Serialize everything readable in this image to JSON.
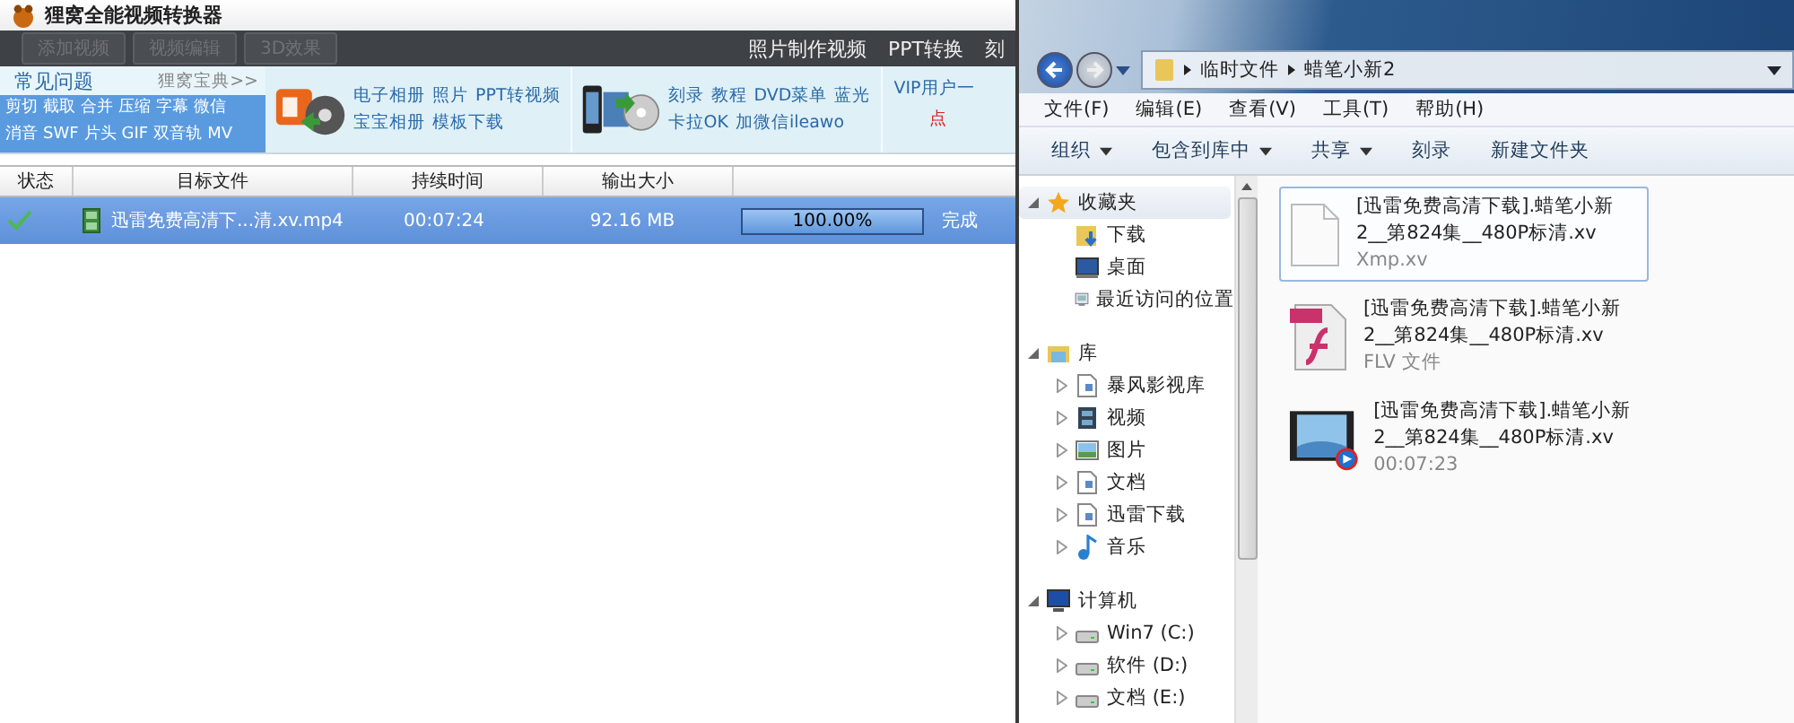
{
  "app": {
    "title": "狸窝全能视频转换器",
    "toolbar_buttons": [
      {
        "label": "添加视频",
        "disabled": true
      },
      {
        "label": "视频编辑",
        "disabled": true
      },
      {
        "label": "3D效果",
        "disabled": true
      }
    ],
    "top_links": [
      "照片制作视频",
      "PPT转换",
      "刻"
    ],
    "faq": {
      "title": "常见问题",
      "more": "狸窝宝典>>",
      "tag_rows": [
        [
          "剪切",
          "截取",
          "合并",
          "压缩",
          "字幕",
          "微信"
        ],
        [
          "消音",
          "SWF",
          "片头",
          "GIF",
          "双音轨",
          "MV"
        ]
      ]
    },
    "promos": [
      {
        "kind": "ppt",
        "lines": [
          [
            "电子相册",
            "照片",
            "PPT转视频"
          ],
          [
            "宝宝相册",
            "模板下载"
          ]
        ]
      },
      {
        "kind": "dvd",
        "lines": [
          [
            "刻录",
            "教程",
            "DVD菜单",
            "蓝光"
          ],
          [
            "卡拉OK",
            "加微信ileawo"
          ]
        ]
      }
    ],
    "vip": {
      "text": "VIP用户一",
      "link": "点"
    },
    "table": {
      "columns": [
        "状态",
        "目标文件",
        "持续时间",
        "输出大小"
      ],
      "rows": [
        {
          "file": "迅雷免费高清下...清.xv.mp4",
          "duration": "00:07:24",
          "size": "92.16 MB",
          "level": 1,
          "progress": "100.00%",
          "result": "完成",
          "selected": true
        }
      ]
    }
  },
  "explorer": {
    "breadcrumb": [
      "临时文件",
      "蜡笔小新2"
    ],
    "menu": [
      "文件(F)",
      "编辑(E)",
      "查看(V)",
      "工具(T)",
      "帮助(H)"
    ],
    "commands": [
      {
        "label": "组织",
        "dropdown": true
      },
      {
        "label": "包含到库中",
        "dropdown": true
      },
      {
        "label": "共享",
        "dropdown": true
      },
      {
        "label": "刻录",
        "dropdown": false
      },
      {
        "label": "新建文件夹",
        "dropdown": false
      }
    ],
    "nav": [
      {
        "label": "收藏夹",
        "selected": true,
        "expanded": true,
        "children": [
          {
            "label": "下载",
            "selected": false
          },
          {
            "label": "桌面",
            "selected": false
          },
          {
            "label": "最近访问的位置",
            "selected": false
          }
        ]
      },
      {
        "label": "库",
        "selected": false,
        "expanded": true,
        "children": [
          {
            "label": "暴风影视库",
            "selected": false,
            "expanded": false
          },
          {
            "label": "视频",
            "selected": false,
            "expanded": false
          },
          {
            "label": "图片",
            "selected": false,
            "expanded": false
          },
          {
            "label": "文档",
            "selected": false,
            "expanded": false
          },
          {
            "label": "迅雷下载",
            "selected": false,
            "expanded": false
          },
          {
            "label": "音乐",
            "selected": false,
            "expanded": false
          }
        ]
      },
      {
        "label": "计算机",
        "selected": false,
        "expanded": true,
        "children": [
          {
            "label": "Win7 (C:)",
            "selected": false,
            "expanded": false
          },
          {
            "label": "软件 (D:)",
            "selected": false,
            "expanded": false
          },
          {
            "label": "文档 (E:)",
            "selected": false,
            "expanded": false
          }
        ]
      }
    ],
    "files": [
      {
        "kind": "blank",
        "name": "[迅雷免费高清下载].蜡笔小新2__第824集__480P标清.xv",
        "detail": "Xmp.xv",
        "selected": true
      },
      {
        "kind": "flv",
        "name": "[迅雷免费高清下载].蜡笔小新2__第824集__480P标清.xv",
        "detail": "FLV 文件",
        "selected": false
      },
      {
        "kind": "video",
        "name": "[迅雷免费高清下载].蜡笔小新2__第824集__480P标清.xv",
        "detail": "00:07:23",
        "selected": false
      }
    ]
  }
}
